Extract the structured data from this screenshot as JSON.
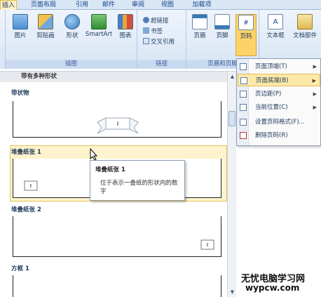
{
  "tabs": [
    "插入",
    "页面布局",
    "引用",
    "邮件",
    "审阅",
    "视图",
    "加载项"
  ],
  "ribbon": {
    "illustrations": {
      "label": "插图",
      "buttons": [
        "图片",
        "剪贴画",
        "形状",
        "SmartArt",
        "图表"
      ]
    },
    "links": {
      "label": "链接",
      "buttons": [
        "超链接",
        "书签",
        "交叉引用"
      ]
    },
    "header_footer": {
      "label": "页眉和页脚",
      "buttons": [
        "页眉",
        "页脚",
        "页码"
      ]
    },
    "text": {
      "buttons": [
        "文本框",
        "文档部件"
      ]
    }
  },
  "gallery": {
    "title": "带有多种形状",
    "items": [
      "带状物",
      "堆叠纸张 1",
      "堆叠纸张 2",
      "方框 1"
    ]
  },
  "tooltip": {
    "title": "堆叠纸张 1",
    "description": "位于表示一叠纸的形状内的数字"
  },
  "menu": {
    "items": [
      {
        "label": "页面顶端(T)",
        "submenu": true
      },
      {
        "label": "页面底端(B)",
        "submenu": true
      },
      {
        "label": "页边距(P)",
        "submenu": true
      },
      {
        "label": "当前位置(C)",
        "submenu": true
      },
      {
        "label": "设置页码格式(F)...",
        "submenu": false
      },
      {
        "label": "删除页码(R)",
        "submenu": false
      }
    ]
  },
  "watermark": {
    "line1": "无忧电脑学习网",
    "line2": "wypcw.com"
  },
  "colors": {
    "ribbon_bg": "#dbe7f5",
    "highlight": "#fcd36a",
    "tab_active": "#fef3c8",
    "accent": "#15428b"
  }
}
